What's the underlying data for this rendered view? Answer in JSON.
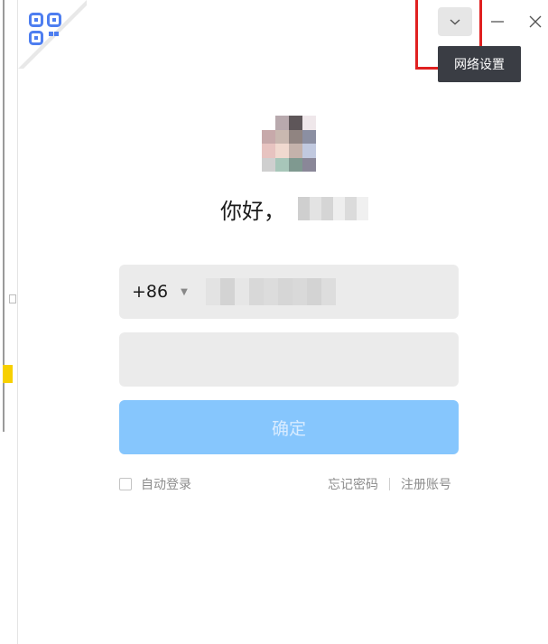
{
  "titlebar": {
    "tooltip": "网络设置"
  },
  "login": {
    "greeting": "你好，",
    "country_code": "+86",
    "confirm_label": "确定",
    "auto_login_label": "自动登录",
    "forgot_password_label": "忘记密码",
    "register_label": "注册账号"
  },
  "colors": {
    "accent_button": "#86c6fd",
    "qr_icon": "#4e7ef0",
    "highlight": "#e02020",
    "tooltip_bg": "#3a3d44",
    "field_bg": "#ebebeb"
  },
  "icons": {
    "qr": "qr-code-icon",
    "dropdown": "chevron-down-icon",
    "minimize": "minimize-icon",
    "close": "close-icon",
    "caret": "caret-down-icon"
  }
}
